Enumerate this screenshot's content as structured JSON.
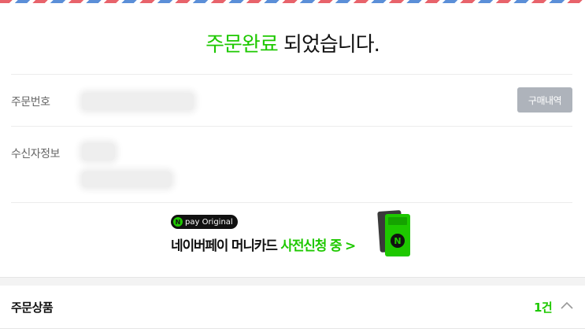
{
  "header": {
    "title_highlight": "주문완료",
    "title_rest": " 되었습니다."
  },
  "order_info": {
    "order_number_label": "주문번호",
    "purchase_history_button": "구매내역",
    "recipient_label": "수신자정보"
  },
  "promo_banner": {
    "badge": "pay Original",
    "badge_icon": "N",
    "text_main": "네이버페이 머니카드 ",
    "text_highlight": "사전신청 중 >",
    "card_icon_letter": "N"
  },
  "order_items": {
    "title": "주문상품",
    "count": "1건"
  },
  "colors": {
    "accent_green": "#1ec800",
    "button_gray": "#aeb3bb",
    "airmail_red": "#e8636b",
    "airmail_blue": "#5b8fd8"
  }
}
